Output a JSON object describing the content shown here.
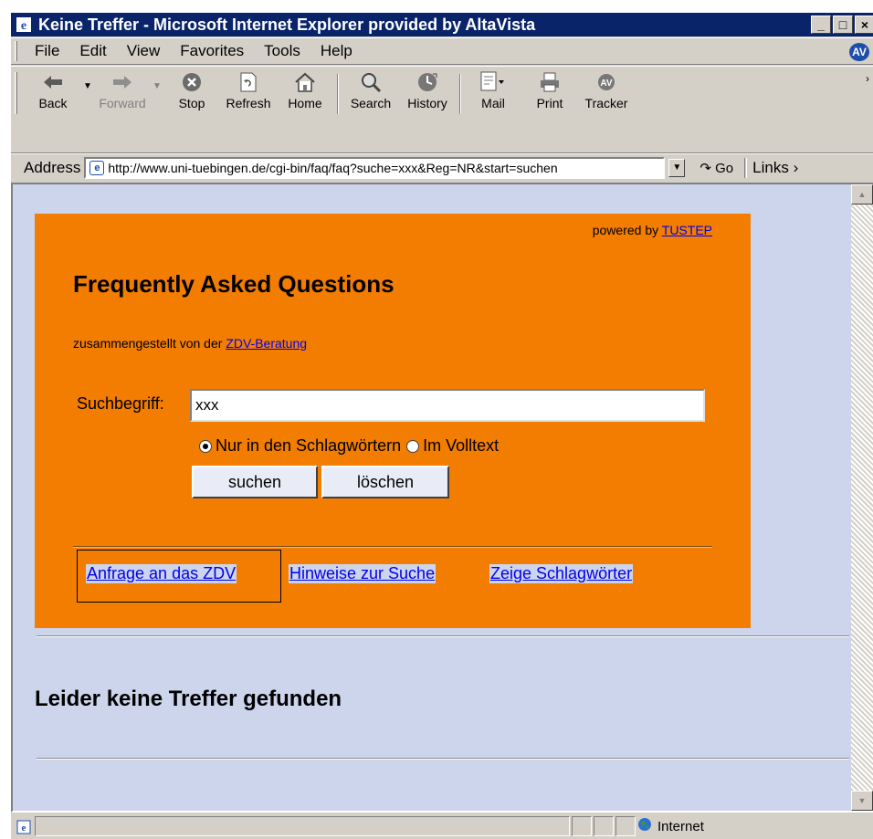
{
  "window": {
    "title": "Keine Treffer - Microsoft Internet Explorer provided by AltaVista",
    "controls": [
      "_",
      "□",
      "×"
    ]
  },
  "menu": {
    "items": [
      "File",
      "Edit",
      "View",
      "Favorites",
      "Tools",
      "Help"
    ],
    "brand_logo": "AV"
  },
  "toolbar": {
    "buttons": [
      {
        "label": "Back",
        "icon": "back-arrow-icon"
      },
      {
        "label": "Forward",
        "icon": "forward-arrow-icon"
      },
      {
        "label": "Stop",
        "icon": "stop-icon"
      },
      {
        "label": "Refresh",
        "icon": "refresh-icon"
      },
      {
        "label": "Home",
        "icon": "home-icon"
      },
      {
        "label": "Search",
        "icon": "search-icon"
      },
      {
        "label": "History",
        "icon": "history-icon"
      },
      {
        "label": "Mail",
        "icon": "mail-icon"
      },
      {
        "label": "Print",
        "icon": "print-icon"
      },
      {
        "label": "Tracker",
        "icon": "tracker-icon"
      }
    ]
  },
  "address": {
    "label": "Address",
    "url": "http://www.uni-tuebingen.de/cgi-bin/faq/faq?suche=xxx&Reg=NR&start=suchen",
    "go_label": "Go",
    "links_label": "Links"
  },
  "page": {
    "powered_by_prefix": "powered by ",
    "powered_by_link": "TUSTEP",
    "title": "Frequently Asked Questions",
    "compiled_prefix": "zusammengestellt von der ",
    "compiled_link": "ZDV-Beratung",
    "search_label": "Suchbegriff:",
    "search_value": "xxx",
    "radio_keywords": "Nur in den Schlagwörtern",
    "radio_fulltext": "Im Volltext",
    "radio_selected": "keywords",
    "btn_search": "suchen",
    "btn_clear": "löschen",
    "link_request": "Anfrage an das ZDV",
    "link_hints": "Hinweise zur Suche",
    "link_keywords": "Zeige Schlagwörter",
    "no_results": "Leider keine Treffer gefunden"
  },
  "status": {
    "zone": "Internet"
  },
  "colors": {
    "faq_box": "#f27d00",
    "page_background": "#cdd5ec",
    "title_bar": "#0a246a",
    "link": "#0000ee"
  }
}
